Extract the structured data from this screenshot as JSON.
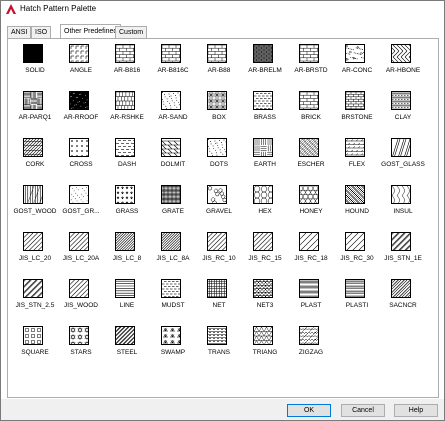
{
  "window": {
    "title": "Hatch Pattern Palette",
    "app_icon": "autocad-icon",
    "accent_color": "#c8102e"
  },
  "tabs": [
    {
      "label": "ANSI",
      "active": false
    },
    {
      "label": "ISO",
      "active": false
    },
    {
      "label": "Other Predefined",
      "active": true
    },
    {
      "label": "Custom",
      "active": false
    }
  ],
  "patterns": [
    {
      "name": "SOLID",
      "kind": "solid"
    },
    {
      "name": "ANGLE",
      "kind": "angle"
    },
    {
      "name": "AR-B816",
      "kind": "brick"
    },
    {
      "name": "AR-B816C",
      "kind": "brick"
    },
    {
      "name": "AR-B88",
      "kind": "brick"
    },
    {
      "name": "AR-BRELM",
      "kind": "brick_dense"
    },
    {
      "name": "AR-BRSTD",
      "kind": "brick"
    },
    {
      "name": "AR-CONC",
      "kind": "dots_dense"
    },
    {
      "name": "AR-HBONE",
      "kind": "herringbone"
    },
    {
      "name": "AR-PARQ1",
      "kind": "parquet"
    },
    {
      "name": "AR-RROOF",
      "kind": "dots_black"
    },
    {
      "name": "AR-RSHKE",
      "kind": "shake"
    },
    {
      "name": "AR-SAND",
      "kind": "dots"
    },
    {
      "name": "BOX",
      "kind": "box"
    },
    {
      "name": "BRASS",
      "kind": "hlines_dash"
    },
    {
      "name": "BRICK",
      "kind": "brick"
    },
    {
      "name": "BRSTONE",
      "kind": "brick_small"
    },
    {
      "name": "CLAY",
      "kind": "clay"
    },
    {
      "name": "CORK",
      "kind": "cork"
    },
    {
      "name": "CROSS",
      "kind": "cross"
    },
    {
      "name": "DASH",
      "kind": "dash"
    },
    {
      "name": "DOLMIT",
      "kind": "dolmit"
    },
    {
      "name": "DOTS",
      "kind": "dots"
    },
    {
      "name": "EARTH",
      "kind": "earth"
    },
    {
      "name": "ESCHER",
      "kind": "escher"
    },
    {
      "name": "FLEX",
      "kind": "flex"
    },
    {
      "name": "GOST_GLASS",
      "kind": "glass"
    },
    {
      "name": "GOST_WOOD",
      "kind": "wood"
    },
    {
      "name": "GOST_GR...",
      "kind": "dots_small"
    },
    {
      "name": "GRASS",
      "kind": "grass"
    },
    {
      "name": "GRATE",
      "kind": "grate"
    },
    {
      "name": "GRAVEL",
      "kind": "gravel"
    },
    {
      "name": "HEX",
      "kind": "hex"
    },
    {
      "name": "HONEY",
      "kind": "honey"
    },
    {
      "name": "HOUND",
      "kind": "hound"
    },
    {
      "name": "INSUL",
      "kind": "insul"
    },
    {
      "name": "JIS_LC_20",
      "kind": "diag"
    },
    {
      "name": "JIS_LC_20A",
      "kind": "diag"
    },
    {
      "name": "JIS_LC_8",
      "kind": "diag_dense"
    },
    {
      "name": "JIS_LC_8A",
      "kind": "diag_dense"
    },
    {
      "name": "JIS_RC_10",
      "kind": "diag"
    },
    {
      "name": "JIS_RC_15",
      "kind": "diag"
    },
    {
      "name": "JIS_RC_18",
      "kind": "diag_sparse"
    },
    {
      "name": "JIS_RC_30",
      "kind": "diag_sparse"
    },
    {
      "name": "JIS_STN_1E",
      "kind": "diag_pair"
    },
    {
      "name": "JIS_STN_2.5",
      "kind": "diag_pair"
    },
    {
      "name": "JIS_WOOD",
      "kind": "diag"
    },
    {
      "name": "LINE",
      "kind": "hlines"
    },
    {
      "name": "MUDST",
      "kind": "hlines_dash"
    },
    {
      "name": "NET",
      "kind": "net"
    },
    {
      "name": "NET3",
      "kind": "net3"
    },
    {
      "name": "PLAST",
      "kind": "plast"
    },
    {
      "name": "PLASTI",
      "kind": "plasti"
    },
    {
      "name": "SACNCR",
      "kind": "sacncr"
    },
    {
      "name": "SQUARE",
      "kind": "square"
    },
    {
      "name": "STARS",
      "kind": "stars"
    },
    {
      "name": "STEEL",
      "kind": "steel"
    },
    {
      "name": "SWAMP",
      "kind": "swamp"
    },
    {
      "name": "TRANS",
      "kind": "trans"
    },
    {
      "name": "TRIANG",
      "kind": "triang"
    },
    {
      "name": "ZIGZAG",
      "kind": "zigzag"
    }
  ],
  "buttons": {
    "ok": "OK",
    "cancel": "Cancel",
    "help": "Help"
  }
}
